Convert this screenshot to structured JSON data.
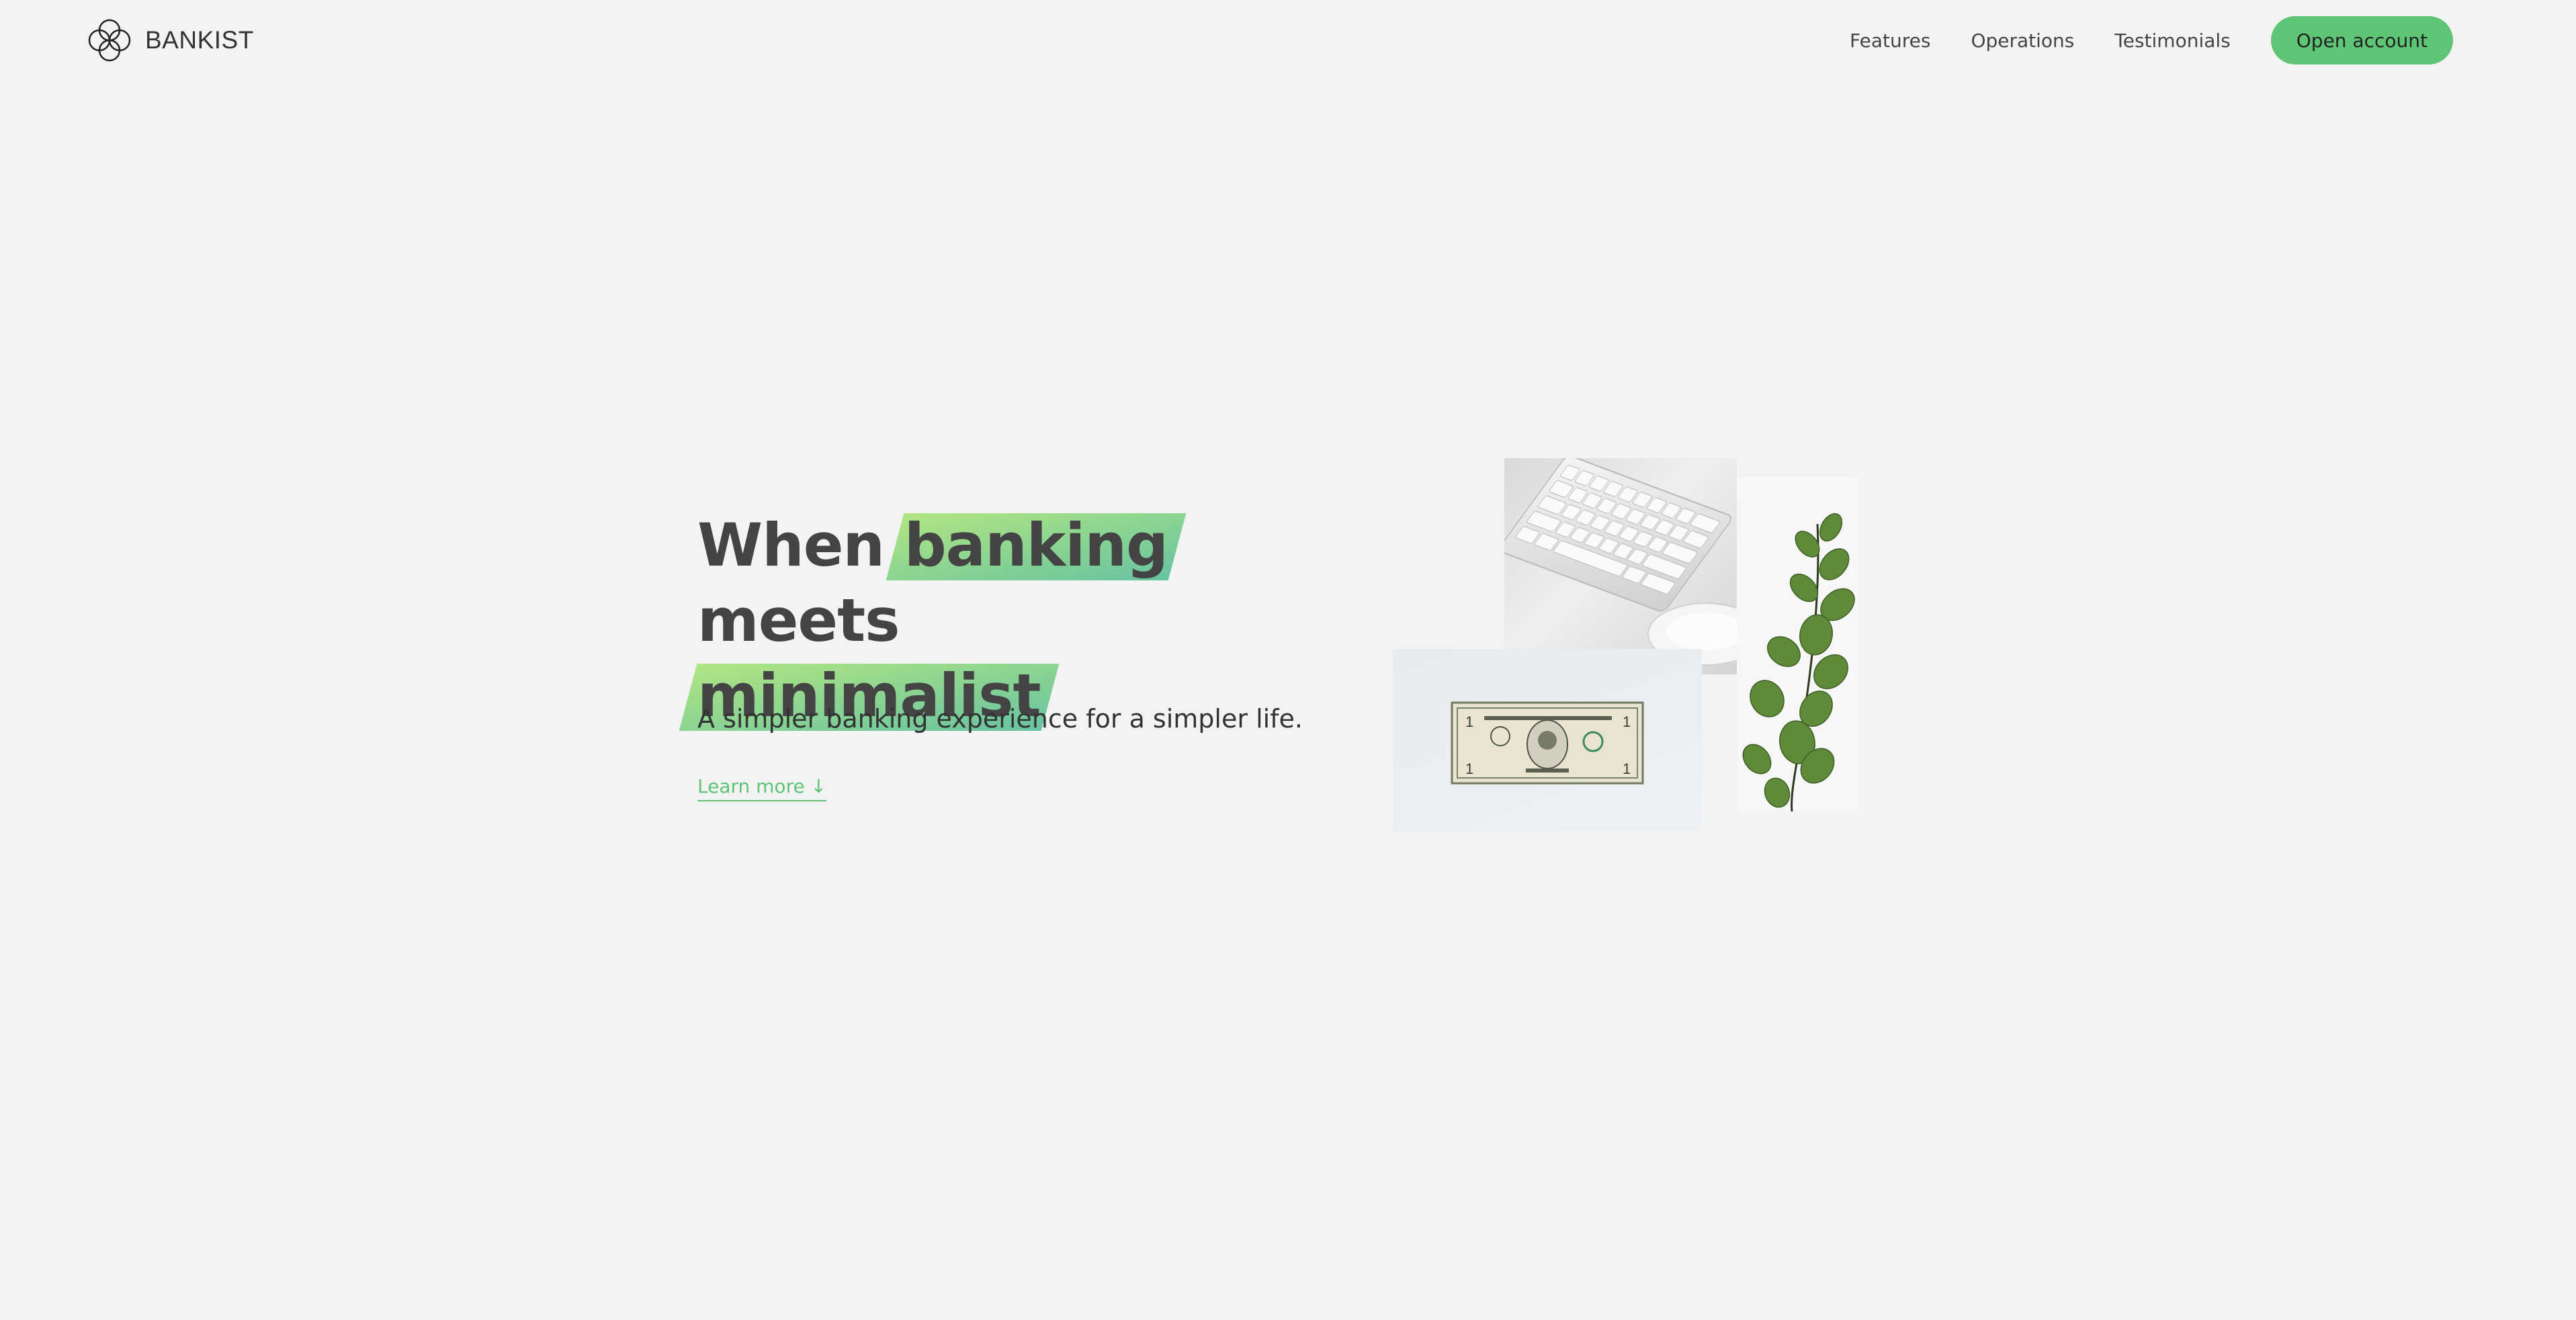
{
  "nav": {
    "brand": "BANKIST",
    "links": [
      "Features",
      "Operations",
      "Testimonials"
    ],
    "cta": "Open account"
  },
  "hero": {
    "title_part1": "When",
    "title_highlight1": "banking",
    "title_part2": "meets",
    "title_highlight2": "minimalist",
    "subtitle": "A simpler banking experience for a simpler life.",
    "learn_more": "Learn more ↓"
  },
  "colors": {
    "background": "#f3f3f3",
    "accent": "#5ec576",
    "highlight_from": "#9be15d",
    "highlight_to": "#39b385"
  },
  "icons": {
    "logo": "four-circle-logo-icon",
    "illustration_keyboard": "keyboard-mouse-image",
    "illustration_bill": "dollar-bill-image",
    "illustration_plant": "eucalyptus-plant-image"
  }
}
